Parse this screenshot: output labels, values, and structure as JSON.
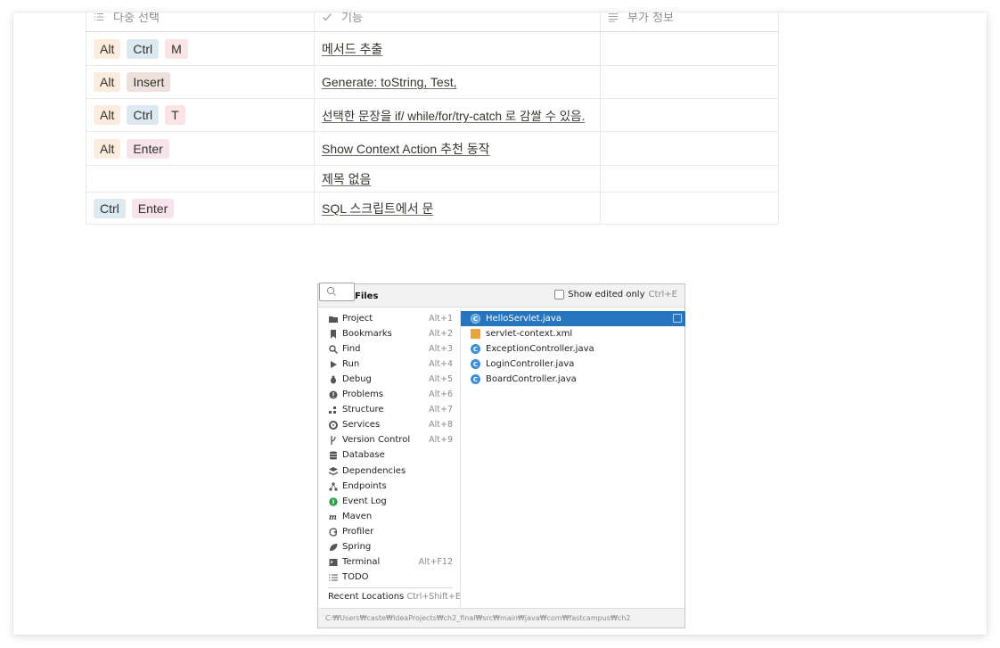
{
  "table": {
    "headers": {
      "col1": "다중 선택",
      "col2": "기능",
      "col3": "부가 정보"
    },
    "rows": [
      {
        "tags": [
          {
            "label": "Alt",
            "color": "#fbecdd"
          },
          {
            "label": "Ctrl",
            "color": "#dde9f0"
          },
          {
            "label": "M",
            "color": "#fbe4e4"
          }
        ],
        "feature": "메서드 추출",
        "extra": ""
      },
      {
        "tags": [
          {
            "label": "Alt",
            "color": "#fbecdd"
          },
          {
            "label": "Insert",
            "color": "#eee0da"
          }
        ],
        "feature": "Generate: toString, Test,",
        "extra": ""
      },
      {
        "tags": [
          {
            "label": "Alt",
            "color": "#fbecdd"
          },
          {
            "label": "Ctrl",
            "color": "#dde9f0"
          },
          {
            "label": "T",
            "color": "#fbe4e4"
          }
        ],
        "feature": "선택한 문장을 if/ while/for/try-catch 로 감쌀 수 있음.",
        "extra": ""
      },
      {
        "tags": [
          {
            "label": "Alt",
            "color": "#fbecdd"
          },
          {
            "label": "Enter",
            "color": "#f6e3ec"
          }
        ],
        "feature": "Show Context Action 추천 동작",
        "extra": ""
      },
      {
        "tags": [],
        "feature": "제목 없음",
        "extra": ""
      },
      {
        "tags": [
          {
            "label": "Ctrl",
            "color": "#dde9f0"
          },
          {
            "label": "Enter",
            "color": "#f6e3ec"
          }
        ],
        "feature": "SQL 스크립트에서 문",
        "extra": ""
      }
    ]
  },
  "switcher": {
    "title": "Files",
    "show_edited_label": "Show edited only",
    "show_edited_shortcut": "Ctrl+E",
    "tool_windows": [
      {
        "label": "Project",
        "shortcut": "Alt+1",
        "icon": "folder-icon"
      },
      {
        "label": "Bookmarks",
        "shortcut": "Alt+2",
        "icon": "bookmark-icon"
      },
      {
        "label": "Find",
        "shortcut": "Alt+3",
        "icon": "search-icon"
      },
      {
        "label": "Run",
        "shortcut": "Alt+4",
        "icon": "play-icon"
      },
      {
        "label": "Debug",
        "shortcut": "Alt+5",
        "icon": "bug-icon"
      },
      {
        "label": "Problems",
        "shortcut": "Alt+6",
        "icon": "warning-icon"
      },
      {
        "label": "Structure",
        "shortcut": "Alt+7",
        "icon": "structure-icon"
      },
      {
        "label": "Services",
        "shortcut": "Alt+8",
        "icon": "services-icon"
      },
      {
        "label": "Version Control",
        "shortcut": "Alt+9",
        "icon": "branch-icon"
      },
      {
        "label": "Database",
        "shortcut": "",
        "icon": "database-icon"
      },
      {
        "label": "Dependencies",
        "shortcut": "",
        "icon": "dependencies-icon"
      },
      {
        "label": "Endpoints",
        "shortcut": "",
        "icon": "endpoints-icon"
      },
      {
        "label": "Event Log",
        "shortcut": "",
        "icon": "event-log-icon"
      },
      {
        "label": "Maven",
        "shortcut": "",
        "icon": "maven-icon"
      },
      {
        "label": "Profiler",
        "shortcut": "",
        "icon": "profiler-icon"
      },
      {
        "label": "Spring",
        "shortcut": "",
        "icon": "spring-icon"
      },
      {
        "label": "Terminal",
        "shortcut": "Alt+F12",
        "icon": "terminal-icon"
      },
      {
        "label": "TODO",
        "shortcut": "",
        "icon": "todo-icon"
      }
    ],
    "recent_locations_label": "Recent Locations",
    "recent_locations_shortcut": "Ctrl+Shift+E",
    "files": [
      {
        "name": "HelloServlet.java",
        "icon": "class-icon",
        "selected": true
      },
      {
        "name": "servlet-context.xml",
        "icon": "xml-icon",
        "selected": false
      },
      {
        "name": "ExceptionController.java",
        "icon": "class-icon",
        "selected": false
      },
      {
        "name": "LoginController.java",
        "icon": "class-icon",
        "selected": false
      },
      {
        "name": "BoardController.java",
        "icon": "class-icon",
        "selected": false
      }
    ],
    "status_path": "C:₩Users₩caste₩IdeaProjects₩ch2_final₩src₩main₩java₩com₩fastcampus₩ch2"
  }
}
